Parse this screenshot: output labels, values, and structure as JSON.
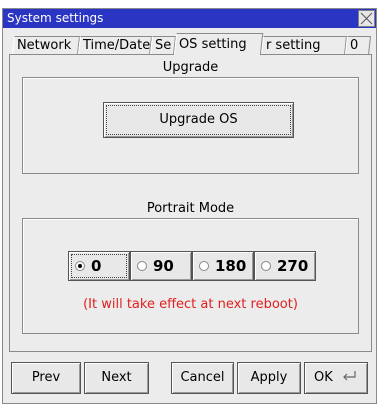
{
  "window": {
    "title": "System settings"
  },
  "tabs": [
    {
      "label": "Network"
    },
    {
      "label": "Time/Date"
    },
    {
      "label": "Se"
    },
    {
      "label": "OS setting"
    },
    {
      "label": "r setting"
    },
    {
      "label": "0"
    }
  ],
  "upgrade": {
    "group_label": "Upgrade",
    "button_label": "Upgrade OS"
  },
  "portrait": {
    "group_label": "Portrait Mode",
    "options": [
      {
        "label": "0"
      },
      {
        "label": "90"
      },
      {
        "label": "180"
      },
      {
        "label": "270"
      }
    ],
    "selected": "0",
    "note": "(It will take effect at next reboot)"
  },
  "footer": {
    "prev": "Prev",
    "next": "Next",
    "cancel": "Cancel",
    "apply": "Apply",
    "ok": "OK"
  },
  "colors": {
    "titlebar": "#2b35c4",
    "note": "#e02020"
  },
  "icons": {
    "close": "close-icon",
    "enter": "enter-icon"
  }
}
